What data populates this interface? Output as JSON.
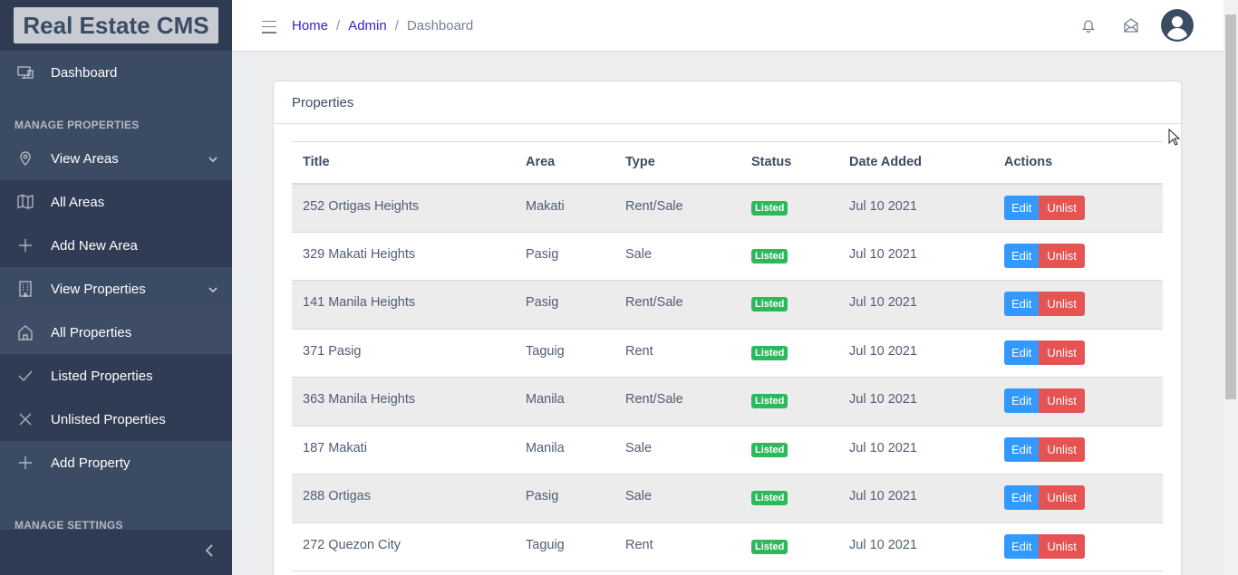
{
  "brand": {
    "name": "Real Estate CMS"
  },
  "sidebar": {
    "dashboard": "Dashboard",
    "section_properties": "MANAGE PROPERTIES",
    "view_areas": "View Areas",
    "all_areas": "All Areas",
    "add_new_area": "Add New Area",
    "view_properties": "View Properties",
    "all_properties": "All Properties",
    "listed_properties": "Listed Properties",
    "unlisted_properties": "Unlisted Properties",
    "add_property": "Add Property",
    "section_settings": "MANAGE SETTINGS"
  },
  "header": {
    "breadcrumb": [
      "Home",
      "Admin",
      "Dashboard"
    ],
    "separator": "/"
  },
  "card": {
    "title": "Properties",
    "columns": [
      "Title",
      "Area",
      "Type",
      "Status",
      "Date Added",
      "Actions"
    ],
    "rows": [
      {
        "title": "252 Ortigas Heights",
        "area": "Makati",
        "type": "Rent/Sale",
        "status": "Listed",
        "date": "Jul 10 2021"
      },
      {
        "title": "329 Makati Heights",
        "area": "Pasig",
        "type": "Sale",
        "status": "Listed",
        "date": "Jul 10 2021"
      },
      {
        "title": "141 Manila Heights",
        "area": "Pasig",
        "type": "Rent/Sale",
        "status": "Listed",
        "date": "Jul 10 2021"
      },
      {
        "title": "371 Pasig",
        "area": "Taguig",
        "type": "Rent",
        "status": "Listed",
        "date": "Jul 10 2021"
      },
      {
        "title": "363 Manila Heights",
        "area": "Manila",
        "type": "Rent/Sale",
        "status": "Listed",
        "date": "Jul 10 2021"
      },
      {
        "title": "187 Makati",
        "area": "Manila",
        "type": "Sale",
        "status": "Listed",
        "date": "Jul 10 2021"
      },
      {
        "title": "288 Ortigas",
        "area": "Pasig",
        "type": "Sale",
        "status": "Listed",
        "date": "Jul 10 2021"
      },
      {
        "title": "272 Quezon City",
        "area": "Taguig",
        "type": "Rent",
        "status": "Listed",
        "date": "Jul 10 2021"
      }
    ],
    "edit_label": "Edit",
    "unlist_label": "Unlist"
  },
  "colors": {
    "sidebar": "#3c4b64",
    "link": "#321fdb",
    "listed_badge": "#2eb85c",
    "edit_button": "#3399ff",
    "unlist_button": "#e55353"
  }
}
